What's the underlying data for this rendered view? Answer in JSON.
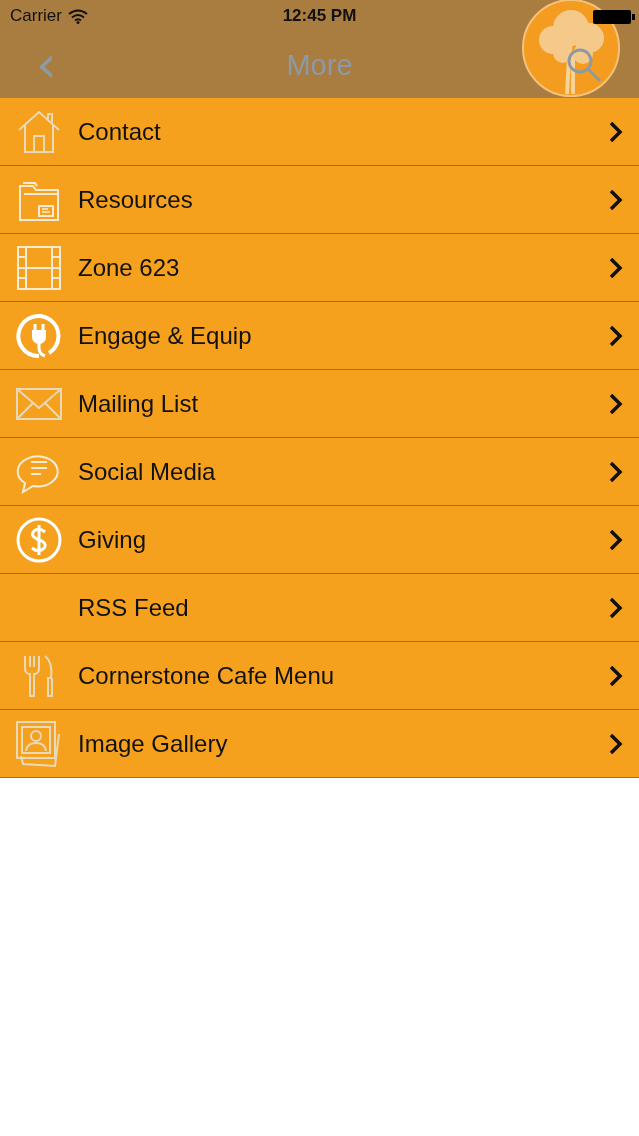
{
  "status_bar": {
    "carrier": "Carrier",
    "time": "12:45 PM"
  },
  "nav_bar": {
    "back": "‹",
    "title": "More"
  },
  "menu": [
    {
      "label": "Contact",
      "kind": "house"
    },
    {
      "label": "Resources",
      "kind": "folder"
    },
    {
      "label": "Zone 623",
      "kind": "film"
    },
    {
      "label": "Engage & Equip",
      "kind": "plug"
    },
    {
      "label": "Mailing List",
      "kind": "envelope"
    },
    {
      "label": "Social Media",
      "kind": "chat"
    },
    {
      "label": "Giving",
      "kind": "dollar"
    },
    {
      "label": "RSS Feed",
      "kind": "plain"
    },
    {
      "label": "Cornerstone Cafe Menu",
      "kind": "utensils"
    },
    {
      "label": "Image Gallery",
      "kind": "photos"
    }
  ]
}
